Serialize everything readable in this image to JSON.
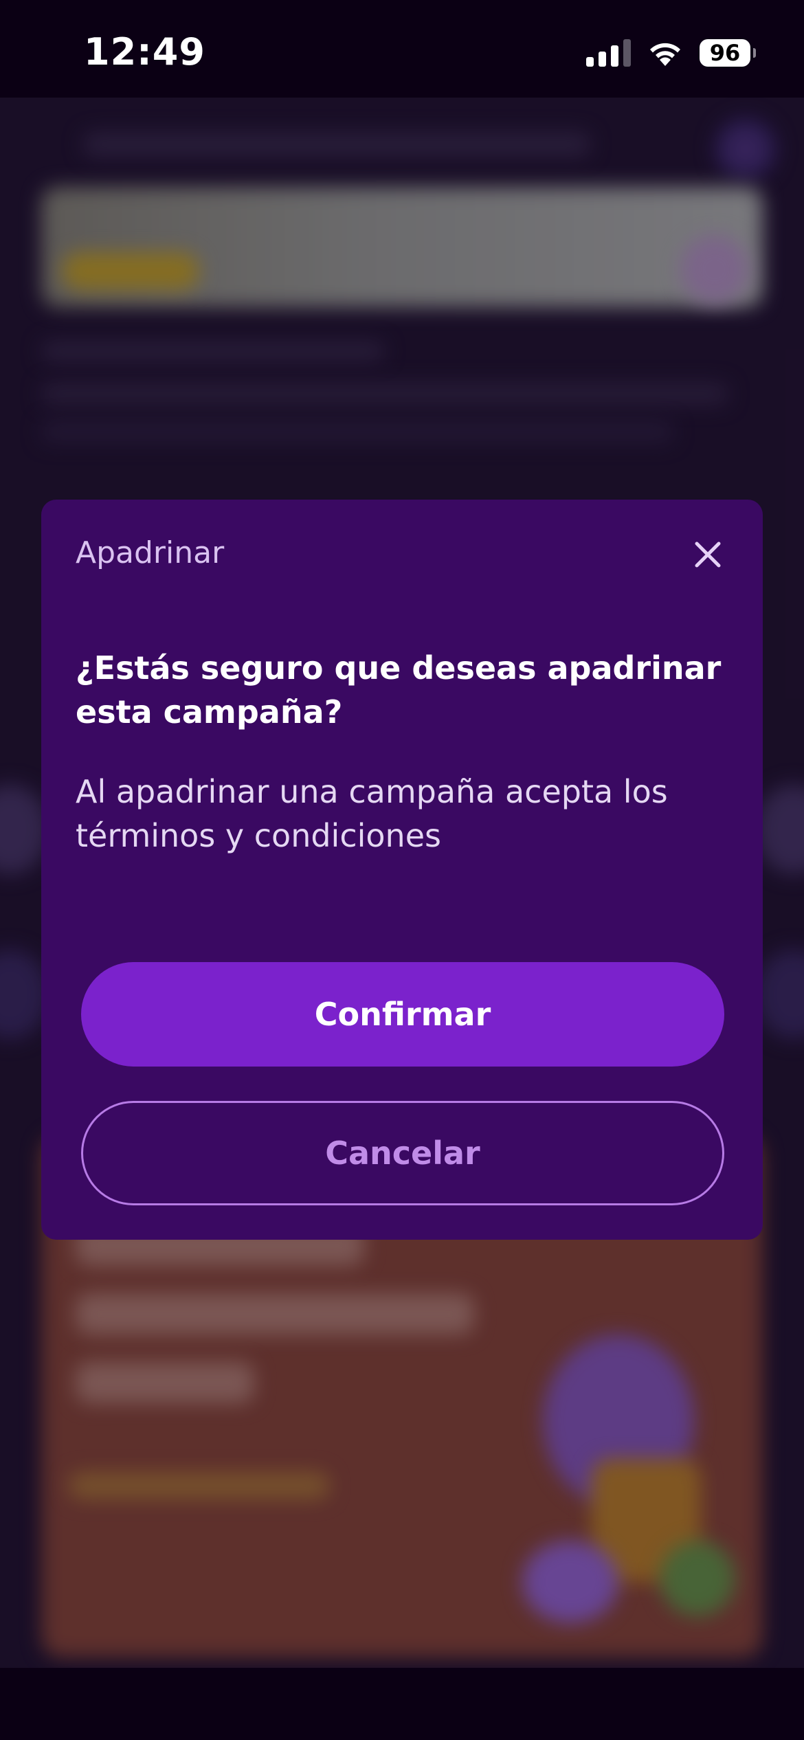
{
  "status_bar": {
    "time": "12:49",
    "battery": "96",
    "icons": [
      "cellular-signal-icon",
      "wifi-icon",
      "battery-icon"
    ]
  },
  "modal": {
    "title": "Apadrinar",
    "close_icon": "close-icon",
    "heading": "¿Estás seguro que deseas apadrinar esta campaña?",
    "body": "Al apadrinar una campaña acepta los términos y condiciones",
    "confirm_label": "Confirmar",
    "cancel_label": "Cancelar"
  },
  "colors": {
    "modal_background": "#3a0962",
    "confirm_button": "#7b22cc",
    "cancel_border": "#b77be6",
    "page_background": "#0b0014"
  }
}
